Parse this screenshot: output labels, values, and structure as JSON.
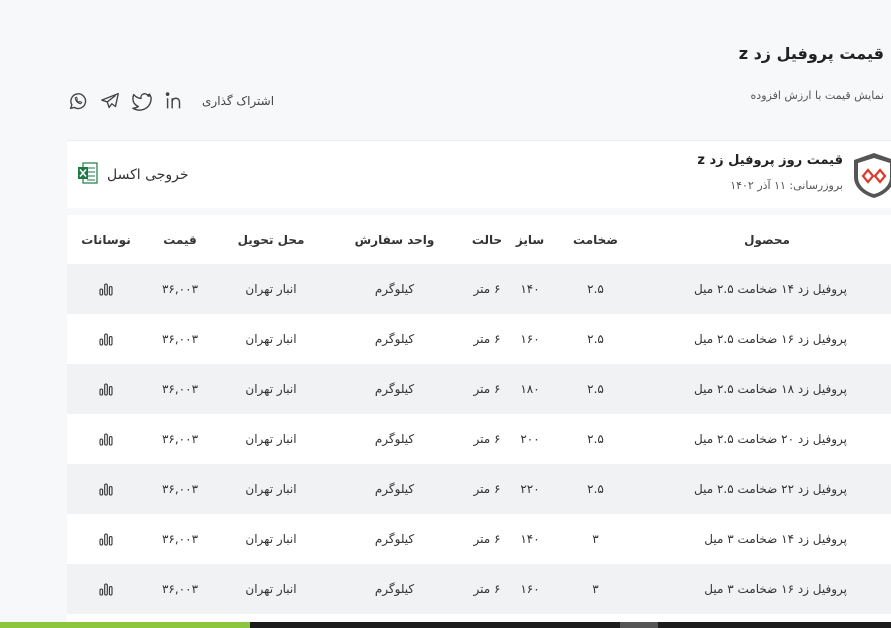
{
  "header": {
    "title": "قیمت پروفیل زد z",
    "vat_toggle_label": "نمایش قیمت با ارزش افزوده"
  },
  "share": {
    "label": "اشتراک گذاری",
    "icons": [
      "linkedin-icon",
      "twitter-icon",
      "telegram-icon",
      "whatsapp-icon"
    ]
  },
  "card": {
    "title": "قیمت روز پروفیل زد z",
    "updated": "بروزرسانی: ۱۱ آذر ۱۴۰۲",
    "excel_label": "خروجی اکسل"
  },
  "table": {
    "headers": {
      "product": "محصول",
      "thickness": "ضخامت",
      "size": "سایز",
      "state": "حالت",
      "unit": "واحد سفارش",
      "location": "محل تحویل",
      "price": "قیمت",
      "fluctuation": "نوسانات"
    },
    "rows": [
      {
        "product": "پروفیل زد ۱۴ ضخامت ۲.۵ میل",
        "thickness": "۲.۵",
        "size": "۱۴۰",
        "state": "۶ متر",
        "unit": "کیلوگرم",
        "location": "انبار تهران",
        "price": "۳۶,۰۰۳"
      },
      {
        "product": "پروفیل زد ۱۶ ضخامت ۲.۵ میل",
        "thickness": "۲.۵",
        "size": "۱۶۰",
        "state": "۶ متر",
        "unit": "کیلوگرم",
        "location": "انبار تهران",
        "price": "۳۶,۰۰۳"
      },
      {
        "product": "پروفیل زد ۱۸ ضخامت ۲.۵ میل",
        "thickness": "۲.۵",
        "size": "۱۸۰",
        "state": "۶ متر",
        "unit": "کیلوگرم",
        "location": "انبار تهران",
        "price": "۳۶,۰۰۳"
      },
      {
        "product": "پروفیل زد ۲۰ ضخامت ۲.۵ میل",
        "thickness": "۲.۵",
        "size": "۲۰۰",
        "state": "۶ متر",
        "unit": "کیلوگرم",
        "location": "انبار تهران",
        "price": "۳۶,۰۰۳"
      },
      {
        "product": "پروفیل زد ۲۲ ضخامت ۲.۵ میل",
        "thickness": "۲.۵",
        "size": "۲۲۰",
        "state": "۶ متر",
        "unit": "کیلوگرم",
        "location": "انبار تهران",
        "price": "۳۶,۰۰۳"
      },
      {
        "product": "پروفیل زد ۱۴ ضخامت ۳ میل",
        "thickness": "۳",
        "size": "۱۴۰",
        "state": "۶ متر",
        "unit": "کیلوگرم",
        "location": "انبار تهران",
        "price": "۳۶,۰۰۳"
      },
      {
        "product": "پروفیل زد ۱۶ ضخامت ۳ میل",
        "thickness": "۳",
        "size": "۱۶۰",
        "state": "۶ متر",
        "unit": "کیلوگرم",
        "location": "انبار تهران",
        "price": "۳۶,۰۰۳"
      }
    ]
  },
  "colors": {
    "accent_red": "#e0392b",
    "excel_green": "#1d7a45",
    "footer_green": "#8cc63f"
  }
}
